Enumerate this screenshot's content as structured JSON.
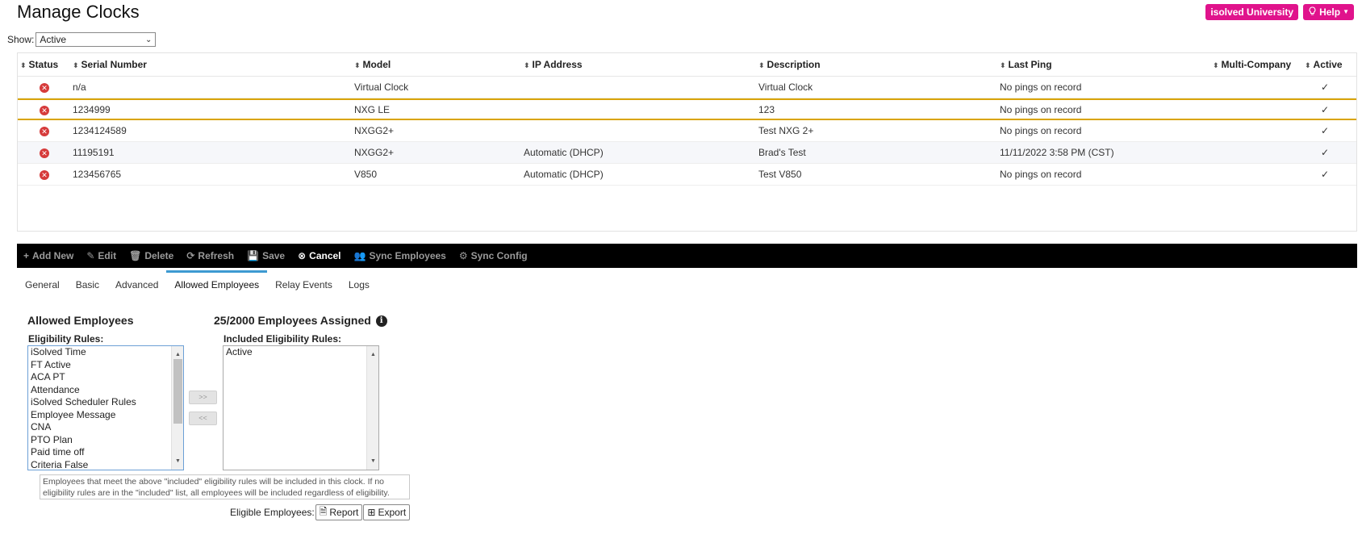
{
  "page": {
    "title": "Manage Clocks"
  },
  "header_buttons": {
    "university": "isolved University",
    "help": "Help"
  },
  "show_filter": {
    "label": "Show:",
    "value": "Active"
  },
  "grid": {
    "columns": [
      "Status",
      "Serial Number",
      "Model",
      "IP Address",
      "Description",
      "Last Ping",
      "Multi-Company",
      "Active"
    ],
    "rows": [
      {
        "serial": "n/a",
        "model": "Virtual Clock",
        "ip": "",
        "description": "Virtual Clock",
        "last_ping": "No pings on record",
        "active": "✓"
      },
      {
        "serial": "1234999",
        "model": "NXG LE",
        "ip": "",
        "description": "123",
        "last_ping": "No pings on record",
        "active": "✓"
      },
      {
        "serial": "1234124589",
        "model": "NXGG2+",
        "ip": "",
        "description": "Test NXG 2+",
        "last_ping": "No pings on record",
        "active": "✓"
      },
      {
        "serial": "11195191",
        "model": "NXGG2+",
        "ip": "Automatic (DHCP)",
        "description": "Brad's Test",
        "last_ping": "11/11/2022 3:58 PM (CST)",
        "active": "✓"
      },
      {
        "serial": "123456765",
        "model": "V850",
        "ip": "Automatic (DHCP)",
        "description": "Test V850",
        "last_ping": "No pings on record",
        "active": "✓"
      }
    ]
  },
  "toolbar": {
    "add_new": "Add New",
    "edit": "Edit",
    "delete": "Delete",
    "refresh": "Refresh",
    "save": "Save",
    "cancel": "Cancel",
    "sync_employees": "Sync Employees",
    "sync_config": "Sync Config"
  },
  "tabs": [
    "General",
    "Basic",
    "Advanced",
    "Allowed Employees",
    "Relay Events",
    "Logs"
  ],
  "allowed": {
    "title": "Allowed Employees",
    "assigned": "25/2000 Employees Assigned",
    "eligibility_label": "Eligibility Rules:",
    "included_label": "Included Eligibility Rules:",
    "eligibility_rules": [
      "iSolved Time",
      "FT Active",
      "ACA PT",
      "Attendance",
      "iSolved Scheduler Rules",
      "Employee Message",
      "CNA",
      "PTO Plan",
      "Paid time off",
      "Criteria False"
    ],
    "included_rules": [
      "Active"
    ],
    "add_btn": ">>",
    "remove_btn": "<<",
    "hint": "Employees that meet the above \"included\" eligibility rules will be included in this clock. If no eligibility rules are in the \"included\" list, all employees will be included regardless of eligibility.",
    "eligible_label": "Eligible Employees:",
    "report": "Report",
    "export": "Export"
  }
}
